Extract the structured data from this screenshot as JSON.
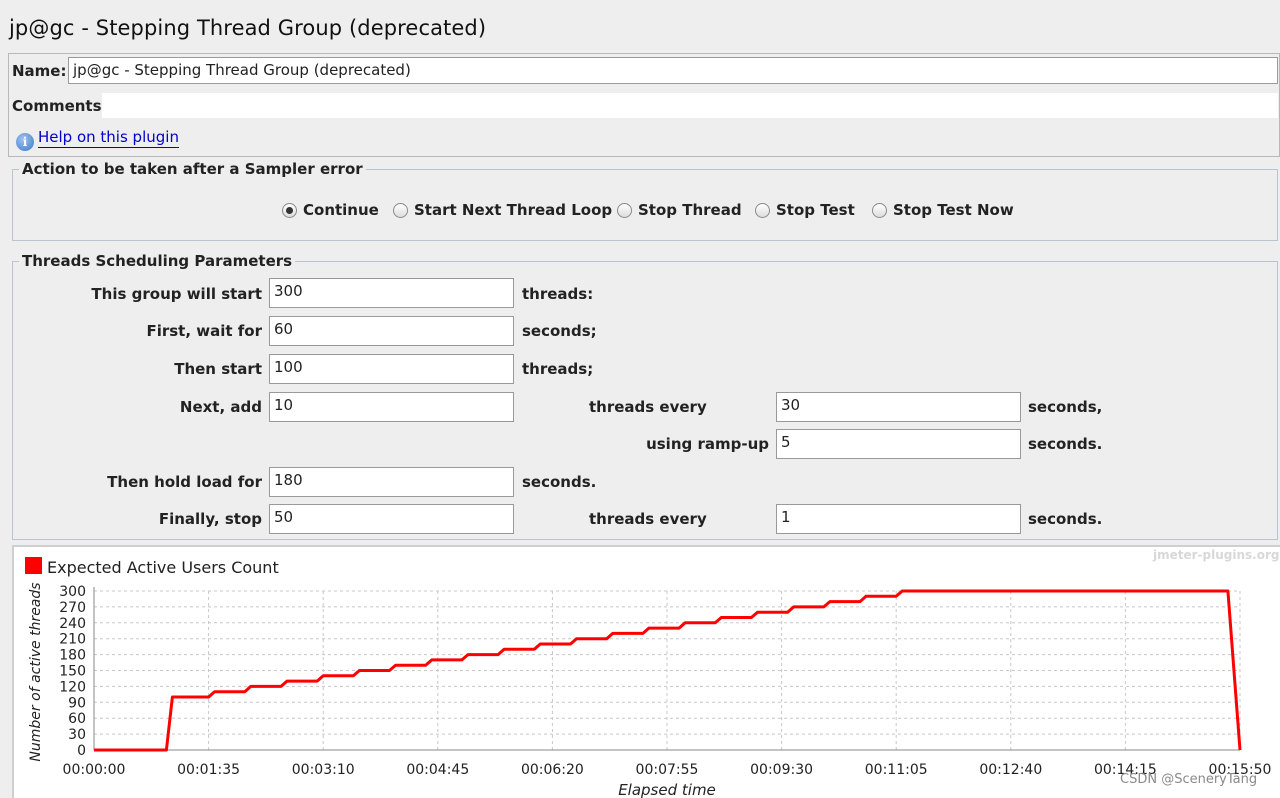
{
  "page": {
    "title": "jp@gc - Stepping Thread Group (deprecated)"
  },
  "name_field": {
    "label": "Name:",
    "value": "jp@gc - Stepping Thread Group (deprecated)"
  },
  "comments_field": {
    "label": "Comments:",
    "value": ""
  },
  "help_link": {
    "label": "Help on this plugin",
    "icon": "info-icon"
  },
  "sampler_error": {
    "legend": "Action to be taken after a Sampler error",
    "options": [
      {
        "label": "Continue",
        "selected": true
      },
      {
        "label": "Start Next Thread Loop",
        "selected": false
      },
      {
        "label": "Stop Thread",
        "selected": false
      },
      {
        "label": "Stop Test",
        "selected": false
      },
      {
        "label": "Stop Test Now",
        "selected": false
      }
    ]
  },
  "scheduling": {
    "legend": "Threads Scheduling Parameters",
    "start_label": "This group will start",
    "start_value": "300",
    "start_unit": "threads:",
    "wait_label": "First, wait for",
    "wait_value": "60",
    "wait_unit": "seconds;",
    "then_start_label": "Then start",
    "then_start_value": "100",
    "then_start_unit": "threads;",
    "add_label": "Next, add",
    "add_value": "10",
    "every_label": "threads every",
    "every_value": "30",
    "every_unit": "seconds,",
    "rampup_label": "using ramp-up",
    "rampup_value": "5",
    "rampup_unit": "seconds.",
    "hold_label": "Then hold load for",
    "hold_value": "180",
    "hold_unit": "seconds.",
    "stop_label": "Finally, stop",
    "stop_value": "50",
    "stop_every_label": "threads every",
    "stop_every_value": "1",
    "stop_every_unit": "seconds."
  },
  "chart_watermark": "jmeter-plugins.org",
  "page_watermark": "CSDN @SceneryTang",
  "chart_data": {
    "type": "line",
    "title": "",
    "xlabel": "Elapsed time",
    "ylabel": "Number of active threads",
    "series": [
      {
        "name": "Expected Active Users Count",
        "color": "#ff0000",
        "x": [
          0,
          60,
          65,
          95,
          100,
          125,
          130,
          155,
          160,
          185,
          190,
          215,
          220,
          245,
          250,
          275,
          280,
          305,
          310,
          335,
          340,
          365,
          370,
          395,
          400,
          425,
          430,
          455,
          460,
          485,
          490,
          515,
          520,
          545,
          550,
          575,
          580,
          605,
          610,
          635,
          640,
          665,
          670,
          695,
          700,
          725,
          730,
          755,
          760,
          940,
          950
        ],
        "y": [
          0,
          0,
          100,
          100,
          110,
          110,
          120,
          120,
          130,
          130,
          140,
          140,
          150,
          150,
          160,
          160,
          170,
          170,
          180,
          180,
          190,
          190,
          200,
          200,
          210,
          210,
          220,
          220,
          230,
          230,
          240,
          240,
          250,
          250,
          260,
          260,
          270,
          270,
          280,
          280,
          290,
          290,
          300,
          300,
          300,
          300,
          300,
          300,
          300,
          300,
          0
        ]
      }
    ],
    "yticks": [
      0,
      30,
      60,
      90,
      120,
      150,
      180,
      210,
      240,
      270,
      300
    ],
    "xticks": [
      0,
      95,
      190,
      285,
      380,
      475,
      570,
      665,
      760,
      855,
      950
    ],
    "xtick_labels": [
      "00:00:00",
      "00:01:35",
      "00:03:10",
      "00:04:45",
      "00:06:20",
      "00:07:55",
      "00:09:30",
      "00:11:05",
      "00:12:40",
      "00:14:15",
      "00:15:50"
    ],
    "xlim": [
      0,
      950
    ],
    "ylim": [
      0,
      300
    ],
    "grid": true,
    "legend": "top-left"
  }
}
